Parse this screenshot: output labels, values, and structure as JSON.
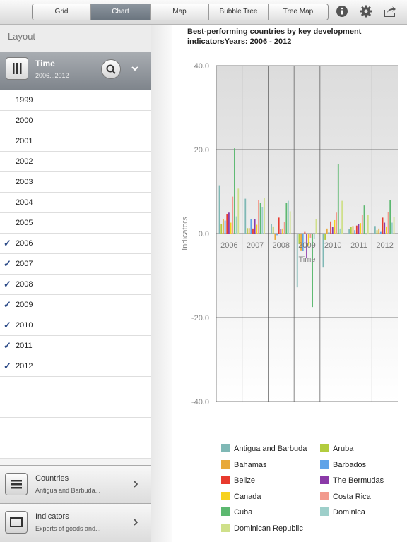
{
  "toolbar": {
    "tabs": [
      {
        "label": "Grid",
        "active": false
      },
      {
        "label": "Chart",
        "active": true
      },
      {
        "label": "Map",
        "active": false
      },
      {
        "label": "Bubble Tree",
        "active": false
      },
      {
        "label": "Tree Map",
        "active": false
      }
    ],
    "icons": [
      "info-icon",
      "gear-icon",
      "share-icon"
    ]
  },
  "layout": {
    "title": "Layout",
    "time": {
      "title": "Time",
      "subtitle": "2006...2012"
    },
    "years": [
      {
        "label": "1999",
        "checked": false
      },
      {
        "label": "2000",
        "checked": false
      },
      {
        "label": "2001",
        "checked": false
      },
      {
        "label": "2002",
        "checked": false
      },
      {
        "label": "2003",
        "checked": false
      },
      {
        "label": "2004",
        "checked": false
      },
      {
        "label": "2005",
        "checked": false
      },
      {
        "label": "2006",
        "checked": true
      },
      {
        "label": "2007",
        "checked": true
      },
      {
        "label": "2008",
        "checked": true
      },
      {
        "label": "2009",
        "checked": true
      },
      {
        "label": "2010",
        "checked": true
      },
      {
        "label": "2011",
        "checked": true
      },
      {
        "label": "2012",
        "checked": true
      }
    ],
    "countries": {
      "title": "Countries",
      "subtitle": "Antigua and Barbuda..."
    },
    "indicators": {
      "title": "Indicators",
      "subtitle": "Exports of goods and..."
    }
  },
  "chart_data": {
    "type": "bar",
    "title": "Best-performing countries by key development indicatorsYears: 2006 - 2012",
    "xlabel": "Time",
    "ylabel": "Indicators",
    "ylim": [
      -40,
      40
    ],
    "yticks": [
      "40.0",
      "20.0",
      "0.0",
      "-20.0",
      "-40.0"
    ],
    "categories": [
      "2006",
      "2007",
      "2008",
      "2009",
      "2010",
      "2011",
      "2012"
    ],
    "series": [
      {
        "name": "Antigua and Barbuda",
        "color": "#7fb8b5",
        "values": [
          11.5,
          8.3,
          2.3,
          -12.8,
          -8.1,
          1.0,
          1.8
        ]
      },
      {
        "name": "Aruba",
        "color": "#b2cc3e",
        "values": [
          2.2,
          1.3,
          1.7,
          -2.5,
          -1.5,
          1.6,
          0.8
        ]
      },
      {
        "name": "Bahamas",
        "color": "#e8a93a",
        "values": [
          3.5,
          1.3,
          -1.5,
          -4.0,
          1.2,
          1.8,
          1.2
        ]
      },
      {
        "name": "Barbados",
        "color": "#5fa3e8",
        "values": [
          3.1,
          3.4,
          -0.4,
          -4.2,
          0.3,
          0.8,
          0.4
        ]
      },
      {
        "name": "Belize",
        "color": "#e83a2e",
        "values": [
          4.7,
          1.2,
          3.8,
          0.4,
          2.9,
          1.9,
          3.8
        ]
      },
      {
        "name": "The Bermudas",
        "color": "#8b3aa8",
        "values": [
          5.0,
          3.5,
          1.0,
          -5.8,
          1.6,
          2.2,
          2.6
        ]
      },
      {
        "name": "Canada",
        "color": "#f7d21e",
        "values": [
          2.6,
          2.1,
          1.2,
          -2.8,
          3.2,
          2.5,
          1.7
        ]
      },
      {
        "name": "Costa Rica",
        "color": "#f29a8e",
        "values": [
          8.8,
          7.9,
          2.7,
          -1.0,
          5.0,
          4.5,
          5.2
        ]
      },
      {
        "name": "Cuba",
        "color": "#5cb870",
        "values": [
          20.3,
          7.3,
          7.3,
          -17.5,
          16.6,
          6.7,
          7.9
        ]
      },
      {
        "name": "Dominica",
        "color": "#9ecfca",
        "values": [
          4.1,
          6.3,
          7.8,
          -1.2,
          1.2,
          -0.2,
          2.6
        ]
      },
      {
        "name": "Dominican Republic",
        "color": "#cfe08a",
        "values": [
          10.7,
          8.5,
          5.3,
          3.5,
          7.8,
          4.5,
          3.9
        ]
      }
    ],
    "grid": true,
    "legend": "bottom"
  }
}
